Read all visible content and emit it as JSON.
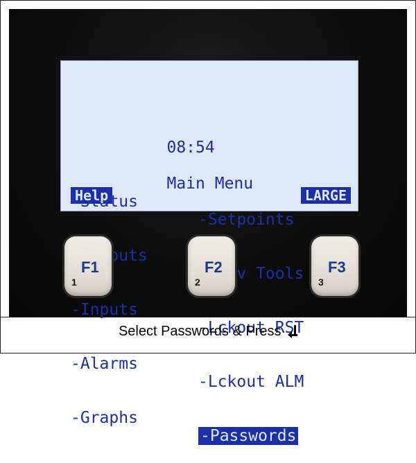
{
  "screen": {
    "time": "08:54",
    "title": "Main Menu",
    "menu_left": [
      "-Status",
      "-Outputs",
      "-Inputs",
      "-Alarms",
      "-Graphs"
    ],
    "menu_right": [
      "-Setpoints",
      "-Serv Tools",
      "-Lckout RST",
      "-Lckout ALM",
      "-Passwords"
    ],
    "selected_item": "-Passwords",
    "softkey_left": "Help",
    "softkey_right": "LARGE"
  },
  "keys": [
    {
      "label": "F1",
      "number": "1"
    },
    {
      "label": "F2",
      "number": "2"
    },
    {
      "label": "F3",
      "number": "3"
    }
  ],
  "caption": {
    "text": "Select Passwords & Press",
    "icon": "enter-return-icon"
  },
  "colors": {
    "lcd_background": "#dfe8f7",
    "lcd_text": "#1a2fa8",
    "key_label": "#1a3a8f"
  }
}
